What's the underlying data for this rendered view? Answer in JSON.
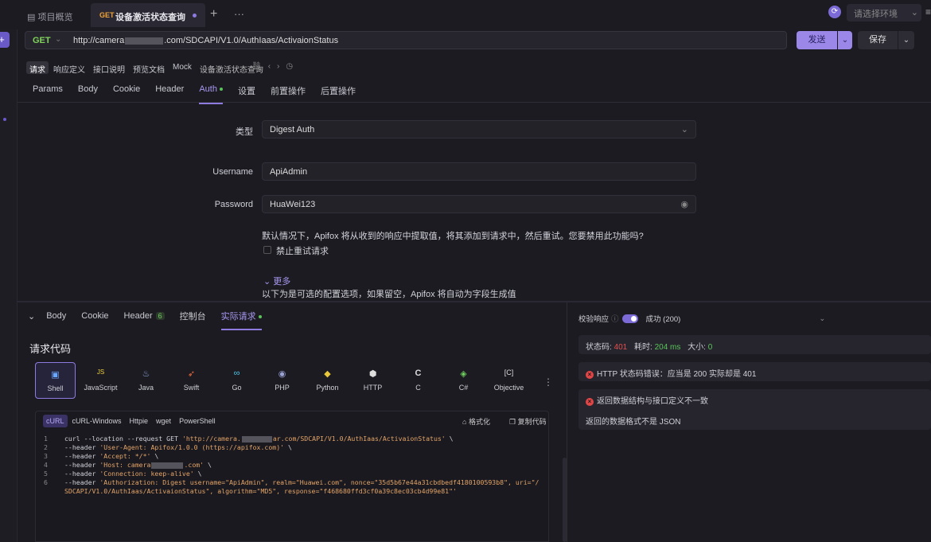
{
  "tabs": {
    "overview": "项目概览",
    "active_method": "GET",
    "active_title": "设备激活状态查询",
    "more": "···"
  },
  "env": {
    "placeholder": "请选择环境"
  },
  "request": {
    "method": "GET",
    "url_prefix": "http://camera",
    "url_suffix": ".com/SDCAPI/V1.0/AuthIaas/ActivaionStatus",
    "send_label": "发送",
    "save_label": "保存"
  },
  "subtabs": [
    "请求",
    "响应定义",
    "接口说明",
    "预览文档",
    "Mock",
    "设备激活状态查询"
  ],
  "param_tabs": [
    "Params",
    "Body",
    "Cookie",
    "Header",
    "Auth",
    "设置",
    "前置操作",
    "后置操作"
  ],
  "auth": {
    "type_label": "类型",
    "type_value": "Digest Auth",
    "username_label": "Username",
    "username_value": "ApiAdmin",
    "password_label": "Password",
    "password_value": "HuaWei123",
    "info": "默认情况下，Apifox 将从收到的响应中提取值，将其添加到请求中，然后重试。您要禁用此功能吗?",
    "disable_retry": "禁止重试请求",
    "more": "更多",
    "optional_info": "以下为是可选的配置选项，如果留空，Apifox 将自动为字段生成值"
  },
  "bottom_tabs": {
    "body": "Body",
    "cookie": "Cookie",
    "header": "Header",
    "header_count": "6",
    "console": "控制台",
    "actual": "实际请求"
  },
  "code": {
    "title": "请求代码",
    "languages": [
      {
        "name": "Shell",
        "icon": "▣"
      },
      {
        "name": "JavaScript",
        "icon": "JS"
      },
      {
        "name": "Java",
        "icon": "♨"
      },
      {
        "name": "Swift",
        "icon": "➶"
      },
      {
        "name": "Go",
        "icon": "∞"
      },
      {
        "name": "PHP",
        "icon": "◉"
      },
      {
        "name": "Python",
        "icon": "◆"
      },
      {
        "name": "HTTP",
        "icon": "⬢"
      },
      {
        "name": "C",
        "icon": "C"
      },
      {
        "name": "C#",
        "icon": "◈"
      },
      {
        "name": "Objective",
        "icon": "[C]"
      }
    ],
    "variants": [
      "cURL",
      "cURL-Windows",
      "Httpie",
      "wget",
      "PowerShell"
    ],
    "format_label": "格式化",
    "copy_label": "复制代码",
    "lines": [
      {
        "n": "1",
        "pre": "curl --location --request GET ",
        "s": "'http://camera.",
        "s2": "ar.com/SDCAPI/V1.0/AuthIaas/ActivaionStatus'",
        "post": " \\"
      },
      {
        "n": "2",
        "pre": "--header ",
        "s": "'User-Agent: Apifox/1.0.0 (https://apifox.com)'",
        "post": " \\"
      },
      {
        "n": "3",
        "pre": "--header ",
        "s": "'Accept: */*'",
        "post": " \\"
      },
      {
        "n": "4",
        "pre": "--header ",
        "s": "'Host: camera",
        "s2": ".com'",
        "post": " \\"
      },
      {
        "n": "5",
        "pre": "--header ",
        "s": "'Connection: keep-alive'",
        "post": " \\"
      },
      {
        "n": "6",
        "pre": "--header ",
        "s": "'Authorization: Digest username=\"ApiAdmin\", realm=\"Huawei.com\", nonce=\"35d5b67e44a31cbdbedf4180100593b8\", uri=\"/",
        "post": ""
      },
      {
        "n": "",
        "pre": "",
        "s": "SDCAPI/V1.0/AuthIaas/ActivaionStatus\", algorithm=\"MD5\", response=\"f468680ffd3cf0a39c8ec03cb4d99e81\"'",
        "post": ""
      }
    ]
  },
  "response": {
    "validate_label": "校验响应",
    "validate_result": "成功 (200)",
    "status_label": "状态码:",
    "status_value": "401",
    "time_label": "耗时:",
    "time_value": "204 ms",
    "size_label": "大小:",
    "size_value": "0",
    "error1": "HTTP 状态码错误：应当是 200 实际却是 401",
    "error2_title": "返回数据结构与接口定义不一致",
    "error2_detail": "返回的数据格式不是 JSON"
  }
}
